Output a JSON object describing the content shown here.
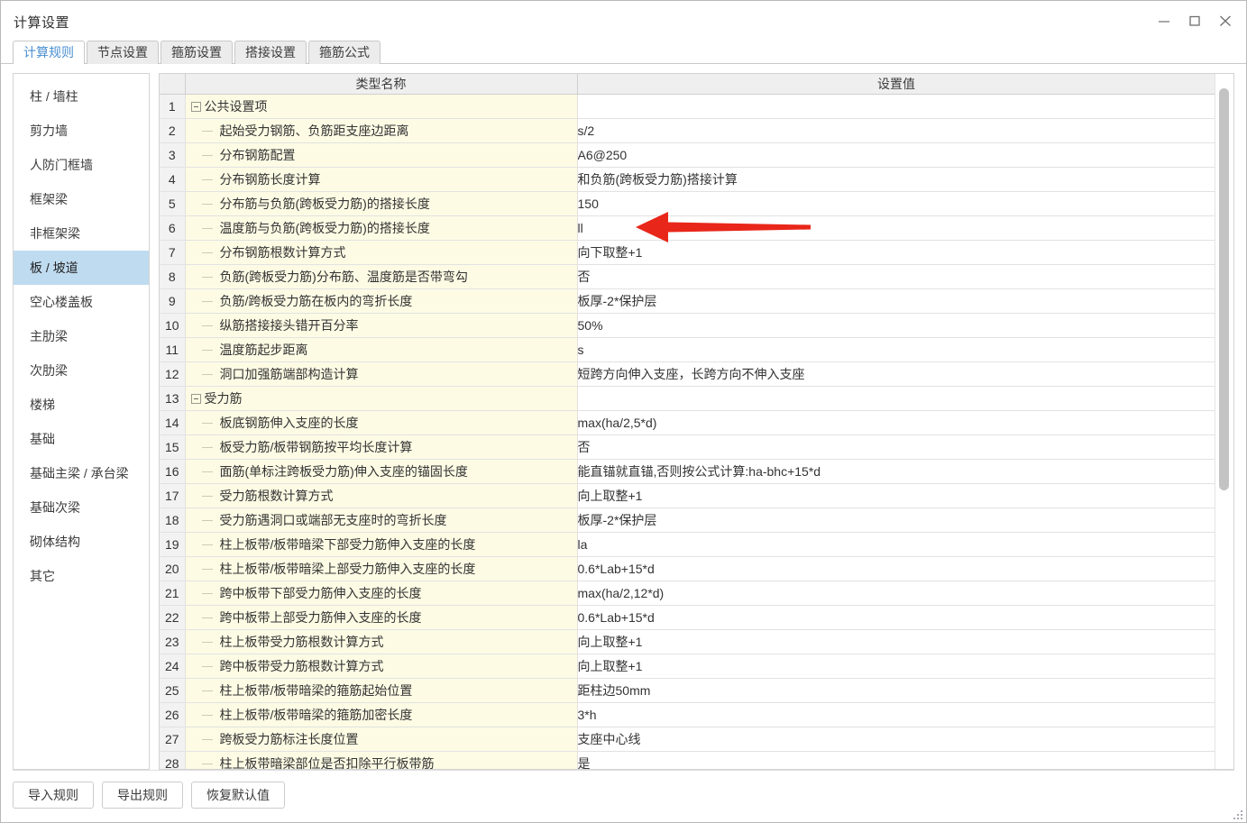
{
  "window": {
    "title": "计算设置",
    "controls": [
      {
        "name": "minimize-button",
        "icon": "minimize-icon"
      },
      {
        "name": "maximize-button",
        "icon": "maximize-icon"
      },
      {
        "name": "close-button",
        "icon": "close-icon"
      }
    ]
  },
  "tabs": [
    {
      "label": "计算规则",
      "active": true
    },
    {
      "label": "节点设置",
      "active": false
    },
    {
      "label": "箍筋设置",
      "active": false
    },
    {
      "label": "搭接设置",
      "active": false
    },
    {
      "label": "箍筋公式",
      "active": false
    }
  ],
  "sidebar": {
    "items": [
      {
        "label": "柱 / 墙柱",
        "selected": false
      },
      {
        "label": "剪力墙",
        "selected": false
      },
      {
        "label": "人防门框墙",
        "selected": false
      },
      {
        "label": "框架梁",
        "selected": false
      },
      {
        "label": "非框架梁",
        "selected": false
      },
      {
        "label": "板 / 坡道",
        "selected": true
      },
      {
        "label": "空心楼盖板",
        "selected": false
      },
      {
        "label": "主肋梁",
        "selected": false
      },
      {
        "label": "次肋梁",
        "selected": false
      },
      {
        "label": "楼梯",
        "selected": false
      },
      {
        "label": "基础",
        "selected": false
      },
      {
        "label": "基础主梁 / 承台梁",
        "selected": false
      },
      {
        "label": "基础次梁",
        "selected": false
      },
      {
        "label": "砌体结构",
        "selected": false
      },
      {
        "label": "其它",
        "selected": false
      }
    ]
  },
  "table": {
    "columns": [
      "",
      "类型名称",
      "设置值"
    ],
    "rows": [
      {
        "num": "1",
        "name": "公共设置项",
        "value": "",
        "type": "group"
      },
      {
        "num": "2",
        "name": "起始受力钢筋、负筋距支座边距离",
        "value": "s/2",
        "type": "item"
      },
      {
        "num": "3",
        "name": "分布钢筋配置",
        "value": "A6@250",
        "type": "item"
      },
      {
        "num": "4",
        "name": "分布钢筋长度计算",
        "value": "和负筋(跨板受力筋)搭接计算",
        "type": "item"
      },
      {
        "num": "5",
        "name": "分布筋与负筋(跨板受力筋)的搭接长度",
        "value": "150",
        "type": "item"
      },
      {
        "num": "6",
        "name": "温度筋与负筋(跨板受力筋)的搭接长度",
        "value": "ll",
        "type": "item"
      },
      {
        "num": "7",
        "name": "分布钢筋根数计算方式",
        "value": "向下取整+1",
        "type": "item"
      },
      {
        "num": "8",
        "name": "负筋(跨板受力筋)分布筋、温度筋是否带弯勾",
        "value": "否",
        "type": "item"
      },
      {
        "num": "9",
        "name": "负筋/跨板受力筋在板内的弯折长度",
        "value": "板厚-2*保护层",
        "type": "item"
      },
      {
        "num": "10",
        "name": "纵筋搭接接头错开百分率",
        "value": "50%",
        "type": "item"
      },
      {
        "num": "11",
        "name": "温度筋起步距离",
        "value": "s",
        "type": "item"
      },
      {
        "num": "12",
        "name": "洞口加强筋端部构造计算",
        "value": "短跨方向伸入支座，长跨方向不伸入支座",
        "type": "item"
      },
      {
        "num": "13",
        "name": "受力筋",
        "value": "",
        "type": "group"
      },
      {
        "num": "14",
        "name": "板底钢筋伸入支座的长度",
        "value": "max(ha/2,5*d)",
        "type": "item"
      },
      {
        "num": "15",
        "name": "板受力筋/板带钢筋按平均长度计算",
        "value": "否",
        "type": "item"
      },
      {
        "num": "16",
        "name": "面筋(单标注跨板受力筋)伸入支座的锚固长度",
        "value": "能直锚就直锚,否则按公式计算:ha-bhc+15*d",
        "type": "item"
      },
      {
        "num": "17",
        "name": "受力筋根数计算方式",
        "value": "向上取整+1",
        "type": "item"
      },
      {
        "num": "18",
        "name": "受力筋遇洞口或端部无支座时的弯折长度",
        "value": "板厚-2*保护层",
        "type": "item"
      },
      {
        "num": "19",
        "name": "柱上板带/板带暗梁下部受力筋伸入支座的长度",
        "value": "la",
        "type": "item"
      },
      {
        "num": "20",
        "name": "柱上板带/板带暗梁上部受力筋伸入支座的长度",
        "value": "0.6*Lab+15*d",
        "type": "item"
      },
      {
        "num": "21",
        "name": "跨中板带下部受力筋伸入支座的长度",
        "value": "max(ha/2,12*d)",
        "type": "item"
      },
      {
        "num": "22",
        "name": "跨中板带上部受力筋伸入支座的长度",
        "value": "0.6*Lab+15*d",
        "type": "item"
      },
      {
        "num": "23",
        "name": "柱上板带受力筋根数计算方式",
        "value": "向上取整+1",
        "type": "item"
      },
      {
        "num": "24",
        "name": "跨中板带受力筋根数计算方式",
        "value": "向上取整+1",
        "type": "item"
      },
      {
        "num": "25",
        "name": "柱上板带/板带暗梁的箍筋起始位置",
        "value": "距柱边50mm",
        "type": "item"
      },
      {
        "num": "26",
        "name": "柱上板带/板带暗梁的箍筋加密长度",
        "value": "3*h",
        "type": "item"
      },
      {
        "num": "27",
        "name": "跨板受力筋标注长度位置",
        "value": "支座中心线",
        "type": "item"
      },
      {
        "num": "28",
        "name": "柱上板带暗梁部位是否扣除平行板带筋",
        "value": "是",
        "type": "item"
      }
    ]
  },
  "footer": {
    "buttons": [
      {
        "label": "导入规则",
        "name": "import-rules-button"
      },
      {
        "label": "导出规则",
        "name": "export-rules-button"
      },
      {
        "label": "恢复默认值",
        "name": "restore-defaults-button"
      }
    ]
  },
  "annotation": {
    "type": "arrow",
    "direction": "left",
    "color": "#e8271a",
    "target_row": "3",
    "target_value": "A6@250"
  },
  "colors": {
    "accent": "#4a8fd0",
    "selection": "#bfdbf0",
    "name_cell_bg": "#fdfbe4",
    "header_bg": "#efefef",
    "arrow": "#e8271a"
  }
}
